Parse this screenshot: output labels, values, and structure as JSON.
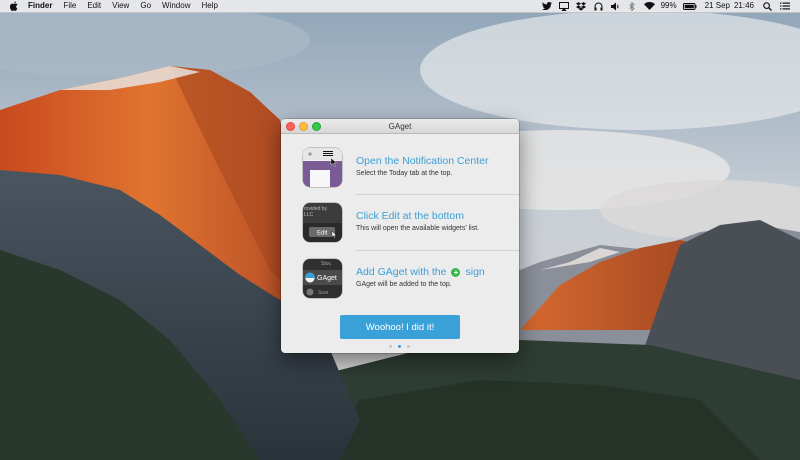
{
  "menubar": {
    "app_name": "Finder",
    "menus": [
      "File",
      "Edit",
      "View",
      "Go",
      "Window",
      "Help"
    ],
    "battery": "99%",
    "date": "21 Sep",
    "time": "21:46",
    "status_icons": [
      "twitter-icon",
      "airplay-icon",
      "dropbox-icon",
      "headphones-icon",
      "volume-icon",
      "bluetooth-icon",
      "wifi-icon",
      "battery-icon",
      "search-icon",
      "list-icon"
    ]
  },
  "window": {
    "title": "GAget",
    "steps": [
      {
        "title": "Open the Notification Center",
        "subtitle": "Select the Today tab at the top."
      },
      {
        "title": "Click Edit at the bottom",
        "subtitle": "This will open the available widgets' list.",
        "thumb_text_1": "rovided by",
        "thumb_text_2": "LLC",
        "thumb_button": "Edit"
      },
      {
        "title_before": "Add GAget with the",
        "title_after": "sign",
        "plus_symbol": "+",
        "subtitle": "GAget will be added to the top.",
        "thumb_text_1": "Stoc",
        "thumb_text_2": "GAget",
        "thumb_text_3": "Sear"
      }
    ],
    "button_label": "Woohoo! I did it!",
    "page_count": 3,
    "current_page": 2
  },
  "colors": {
    "accent": "#3aa0d8",
    "plus_green": "#37b44a",
    "window_bg": "#ececec"
  }
}
